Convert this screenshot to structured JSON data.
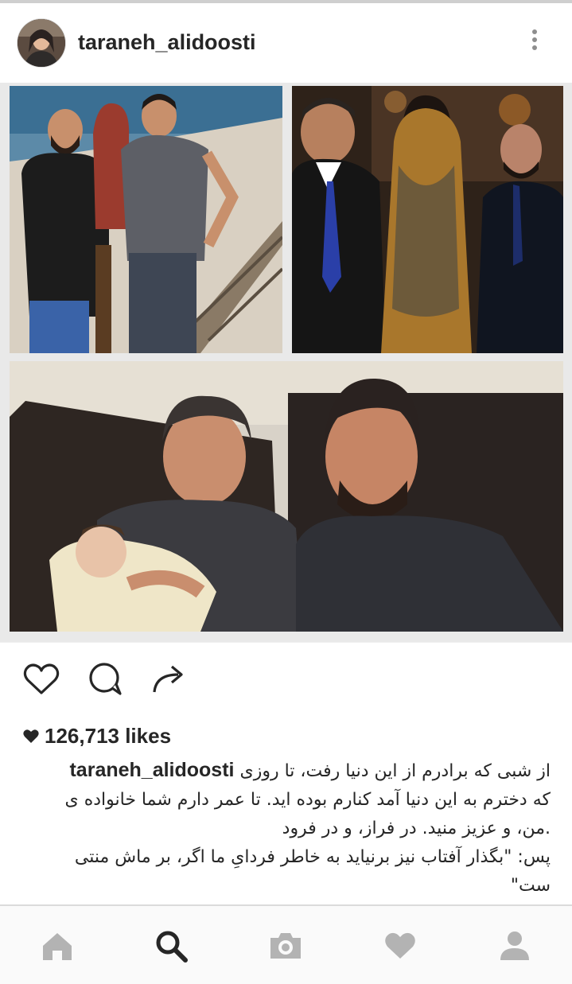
{
  "post": {
    "username": "taraneh_alidoosti",
    "likes": "126,713 likes",
    "caption_lines": [
      "از شبی که برادرم از این دنیا رفت، تا روزی",
      "که دخترم به این دنیا آمد کنارم بوده اید. تا عمر دارم شما خانواده ی",
      ".من، و عزیز منید. در فراز، و در فرود",
      "پس: \"بگذار آفتاب نیز برنیاید به خاطر فردایِ ما اگر، بر ماش منتی",
      "ست\""
    ]
  },
  "icons": {
    "more": "more-vertical-icon",
    "like": "heart-outline-icon",
    "comment": "comment-bubble-icon",
    "share": "share-arrow-icon",
    "likes_heart": "heart-filled-icon",
    "nav": [
      "home-icon",
      "search-icon",
      "camera-icon",
      "heart-icon",
      "profile-icon"
    ]
  },
  "colors": {
    "text": "#262626",
    "icon_gray": "#b3b3b3",
    "nav_active": "#262626"
  }
}
